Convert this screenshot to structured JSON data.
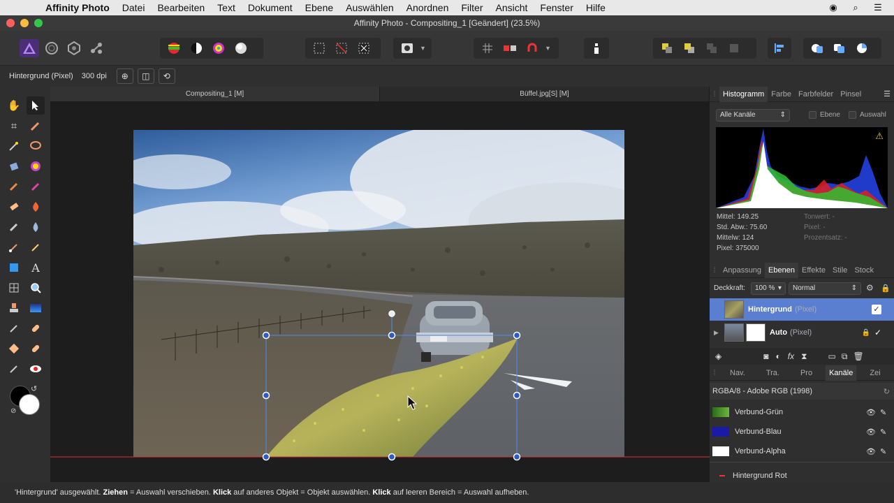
{
  "menubar": {
    "items": [
      "Affinity Photo",
      "Datei",
      "Bearbeiten",
      "Text",
      "Dokument",
      "Ebene",
      "Auswählen",
      "Anordnen",
      "Filter",
      "Ansicht",
      "Fenster",
      "Hilfe"
    ]
  },
  "window": {
    "title": "Affinity Photo - Compositing_1 [Geändert] (23.5%)"
  },
  "context": {
    "layer_label": "Hintergrund (Pixel)",
    "dpi": "300 dpi"
  },
  "doc_tabs": [
    "Compositing_1 [M]",
    "Büffel.jpg[S] [M]"
  ],
  "histogram_panel": {
    "tabs": [
      "Histogramm",
      "Farbe",
      "Farbfelder",
      "Pinsel"
    ],
    "channel_select": "Alle Kanäle",
    "checkbox_layer": "Ebene",
    "checkbox_selection": "Auswahl",
    "stats_left": [
      "Mittel: 149.25",
      "Std. Abw.: 75.60",
      "Mittelw: 124",
      "Pixel: 375000"
    ],
    "stats_right": [
      "Tonwert: -",
      "Pixel: -",
      "Prozentsatz: -"
    ]
  },
  "layers_panel": {
    "tabs": [
      "Anpassung",
      "Ebenen",
      "Effekte",
      "Stile",
      "Stock"
    ],
    "opacity_label": "Deckkraft:",
    "opacity_value": "100 %",
    "blend_mode": "Normal",
    "layers": [
      {
        "name": "Hintergrund",
        "kind": "(Pixel)"
      },
      {
        "name": "Auto",
        "kind": "(Pixel)"
      }
    ]
  },
  "channels_panel": {
    "tabs": [
      "Nav.",
      "Tra.",
      "Pro",
      "Kanäle",
      "Zei"
    ],
    "format": "RGBA/8 - Adobe RGB (1998)",
    "channels": [
      "Verbund-Grün",
      "Verbund-Blau",
      "Verbund-Alpha"
    ],
    "bottom_channel": "Hintergrund Rot"
  },
  "status": {
    "p1": "'Hintergrund' ausgewählt. ",
    "b1": "Ziehen",
    "p2": " = Auswahl verschieben. ",
    "b2": "Klick",
    "p3": " auf anderes Objekt = Objekt auswählen. ",
    "b3": "Klick",
    "p4": " auf leeren Bereich = Auswahl aufheben."
  }
}
